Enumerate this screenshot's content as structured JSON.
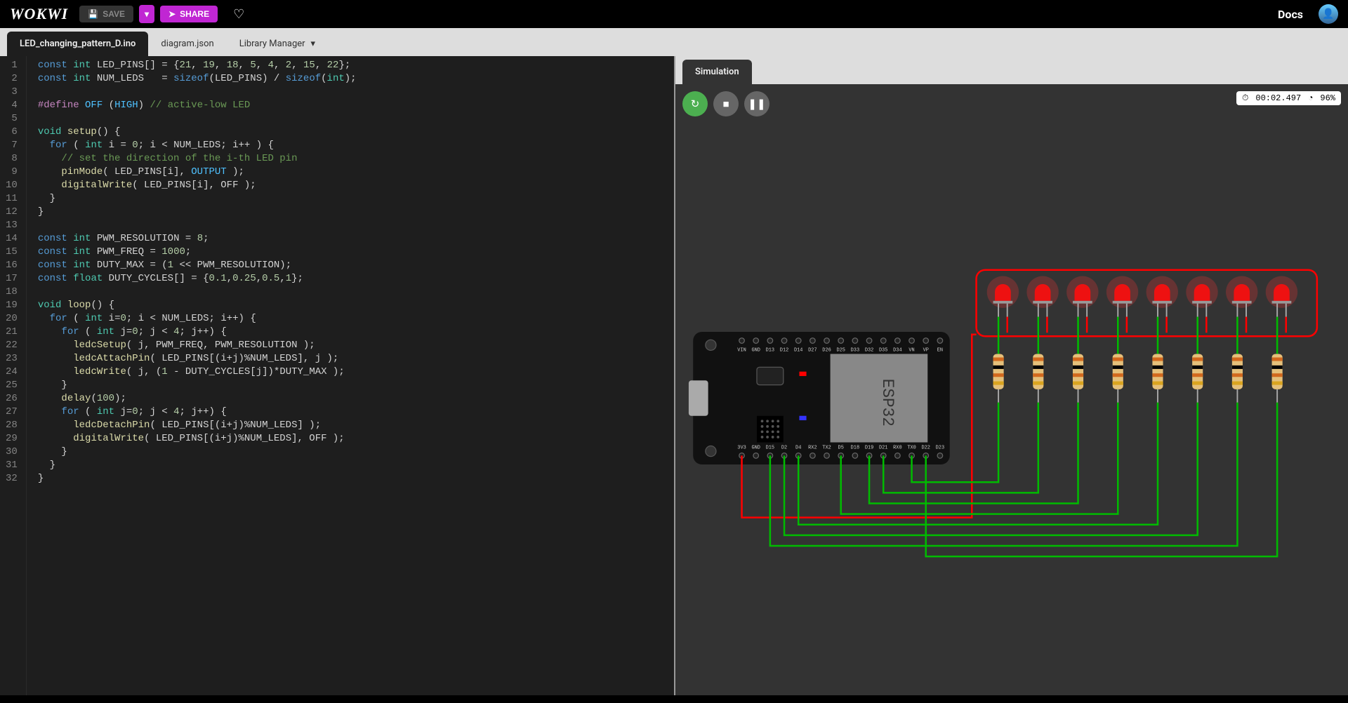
{
  "header": {
    "logo": "WOKWI",
    "save": "SAVE",
    "share": "SHARE",
    "docs": "Docs"
  },
  "tabs": {
    "file": "LED_changing_pattern_D.ino",
    "diagram": "diagram.json",
    "library": "Library Manager"
  },
  "sim": {
    "tab": "Simulation",
    "time": "00:02.497",
    "perf": "96%"
  },
  "board": {
    "chip": "ESP32",
    "pins_top": [
      "VIN",
      "GND",
      "D13",
      "D12",
      "D14",
      "D27",
      "D26",
      "D25",
      "D33",
      "D32",
      "D35",
      "D34",
      "VN",
      "VP",
      "EN"
    ],
    "pins_bot": [
      "3V3",
      "GND",
      "D15",
      "D2",
      "D4",
      "RX2",
      "TX2",
      "D5",
      "D18",
      "D19",
      "D21",
      "RX0",
      "TX0",
      "D22",
      "D23"
    ]
  },
  "code_lines": [
    {
      "n": 1,
      "h": "<span class='tok-kw'>const</span> <span class='tok-type'>int</span> LED_PINS[] = {<span class='tok-num'>21</span>, <span class='tok-num'>19</span>, <span class='tok-num'>18</span>, <span class='tok-num'>5</span>, <span class='tok-num'>4</span>, <span class='tok-num'>2</span>, <span class='tok-num'>15</span>, <span class='tok-num'>22</span>};"
    },
    {
      "n": 2,
      "h": "<span class='tok-kw'>const</span> <span class='tok-type'>int</span> NUM_LEDS   = <span class='tok-kw'>sizeof</span>(LED_PINS) / <span class='tok-kw'>sizeof</span>(<span class='tok-type'>int</span>);"
    },
    {
      "n": 3,
      "h": ""
    },
    {
      "n": 4,
      "h": "<span class='tok-def'>#define</span> <span class='tok-const'>OFF</span> (<span class='tok-const'>HIGH</span>) <span class='tok-com'>// active-low LED</span>"
    },
    {
      "n": 5,
      "h": ""
    },
    {
      "n": 6,
      "h": "<span class='tok-type'>void</span> <span class='tok-fn'>setup</span>() {"
    },
    {
      "n": 7,
      "h": "  <span class='tok-kw'>for</span> ( <span class='tok-type'>int</span> i = <span class='tok-num'>0</span>; i &lt; NUM_LEDS; i++ ) {"
    },
    {
      "n": 8,
      "h": "    <span class='tok-com'>// set the direction of the i-th LED pin</span>"
    },
    {
      "n": 9,
      "h": "    <span class='tok-fn'>pinMode</span>( LED_PINS[i], <span class='tok-const'>OUTPUT</span> );"
    },
    {
      "n": 10,
      "h": "    <span class='tok-fn'>digitalWrite</span>( LED_PINS[i], OFF );"
    },
    {
      "n": 11,
      "h": "  }"
    },
    {
      "n": 12,
      "h": "}"
    },
    {
      "n": 13,
      "h": ""
    },
    {
      "n": 14,
      "h": "<span class='tok-kw'>const</span> <span class='tok-type'>int</span> PWM_RESOLUTION = <span class='tok-num'>8</span>;"
    },
    {
      "n": 15,
      "h": "<span class='tok-kw'>const</span> <span class='tok-type'>int</span> PWM_FREQ = <span class='tok-num'>1000</span>;"
    },
    {
      "n": 16,
      "h": "<span class='tok-kw'>const</span> <span class='tok-type'>int</span> DUTY_MAX = (<span class='tok-num'>1</span> &lt;&lt; PWM_RESOLUTION);"
    },
    {
      "n": 17,
      "h": "<span class='tok-kw'>const</span> <span class='tok-type'>float</span> DUTY_CYCLES[] = {<span class='tok-num'>0.1</span>,<span class='tok-num'>0.25</span>,<span class='tok-num'>0.5</span>,<span class='tok-num'>1</span>};"
    },
    {
      "n": 18,
      "h": ""
    },
    {
      "n": 19,
      "h": "<span class='tok-type'>void</span> <span class='tok-fn'>loop</span>() {"
    },
    {
      "n": 20,
      "h": "  <span class='tok-kw'>for</span> ( <span class='tok-type'>int</span> i=<span class='tok-num'>0</span>; i &lt; NUM_LEDS; i++) {"
    },
    {
      "n": 21,
      "h": "    <span class='tok-kw'>for</span> ( <span class='tok-type'>int</span> j=<span class='tok-num'>0</span>; j &lt; <span class='tok-num'>4</span>; j++) {"
    },
    {
      "n": 22,
      "h": "      <span class='tok-fn'>ledcSetup</span>( j, PWM_FREQ, PWM_RESOLUTION );"
    },
    {
      "n": 23,
      "h": "      <span class='tok-fn'>ledcAttachPin</span>( LED_PINS[(i+j)%NUM_LEDS], j );"
    },
    {
      "n": 24,
      "h": "      <span class='tok-fn'>ledcWrite</span>( j, (<span class='tok-num'>1</span> - DUTY_CYCLES[j])*DUTY_MAX );"
    },
    {
      "n": 25,
      "h": "    }"
    },
    {
      "n": 26,
      "h": "    <span class='tok-fn'>delay</span>(<span class='tok-num'>100</span>);"
    },
    {
      "n": 27,
      "h": "    <span class='tok-kw'>for</span> ( <span class='tok-type'>int</span> j=<span class='tok-num'>0</span>; j &lt; <span class='tok-num'>4</span>; j++) {"
    },
    {
      "n": 28,
      "h": "      <span class='tok-fn'>ledcDetachPin</span>( LED_PINS[(i+j)%NUM_LEDS] );"
    },
    {
      "n": 29,
      "h": "      <span class='tok-fn'>digitalWrite</span>( LED_PINS[(i+j)%NUM_LEDS], OFF );"
    },
    {
      "n": 30,
      "h": "    }"
    },
    {
      "n": 31,
      "h": "  }"
    },
    {
      "n": 32,
      "h": "}"
    }
  ]
}
